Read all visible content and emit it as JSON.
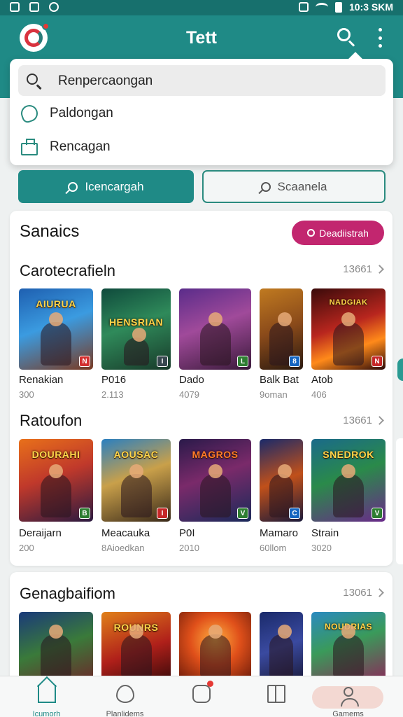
{
  "status_bar": {
    "time": "10:3 SKM"
  },
  "app": {
    "title": "Tett"
  },
  "dropdown": {
    "search_value": "Renpercaongan",
    "items": [
      {
        "label": "Paldongan",
        "icon": "phone-icon"
      },
      {
        "label": "Rencagan",
        "icon": "shopping-bag-icon"
      }
    ]
  },
  "actions": {
    "primary_label": "Icencargah",
    "secondary_label": "Scaanela"
  },
  "card1": {
    "title": "Sanaics",
    "cta_label": "Deadiistrah",
    "sections": [
      {
        "title": "Carotecrafieln",
        "more": "13661",
        "games": [
          {
            "name": "Renakian",
            "meta": "300",
            "cover_text": "AIURUA",
            "badge": "N"
          },
          {
            "name": "P016",
            "meta": "2.113",
            "cover_text": "HENSRIAN",
            "badge": "I"
          },
          {
            "name": "Dado",
            "meta": "4079",
            "cover_text": "",
            "badge": "L"
          },
          {
            "name": "Balk Bat",
            "meta": "9oman",
            "cover_text": "",
            "badge": "8"
          },
          {
            "name": "Atob",
            "meta": "406",
            "cover_text": "NADGIAK",
            "badge": "N"
          }
        ]
      },
      {
        "title": "Ratoufon",
        "more": "13661",
        "games": [
          {
            "name": "Deraijarn",
            "meta": "200",
            "cover_text": "DOURAHI",
            "badge": "B"
          },
          {
            "name": "Meacauka",
            "meta": "8Aioedkan",
            "cover_text": "AOUSAC",
            "badge": "I"
          },
          {
            "name": "P0I",
            "meta": "2010",
            "cover_text": "MAGROS",
            "badge": "V"
          },
          {
            "name": "Mamaro",
            "meta": "60llom",
            "cover_text": "",
            "badge": "C"
          },
          {
            "name": "Strain",
            "meta": "3020",
            "cover_text": "SNEDROK",
            "badge": "V"
          }
        ]
      }
    ]
  },
  "card2": {
    "title": "Genagbaifiom",
    "more": "13061",
    "games": [
      {
        "cover_text": ""
      },
      {
        "cover_text": "ROUNRS"
      },
      {
        "cover_text": ""
      },
      {
        "cover_text": ""
      },
      {
        "cover_text": "NOUDRIAS"
      }
    ]
  },
  "bottom_nav": [
    {
      "label": "Icumorh",
      "icon": "home-icon"
    },
    {
      "label": "Planlidems",
      "icon": "heart-icon"
    },
    {
      "label": "",
      "icon": "notification-icon"
    },
    {
      "label": "",
      "icon": "book-icon"
    },
    {
      "label": "Gamems",
      "icon": "user-icon"
    }
  ],
  "colors": {
    "primary": "#1f8a86",
    "status_bar": "#17706d",
    "cta": "#c2266f",
    "background": "#eef1f1"
  }
}
